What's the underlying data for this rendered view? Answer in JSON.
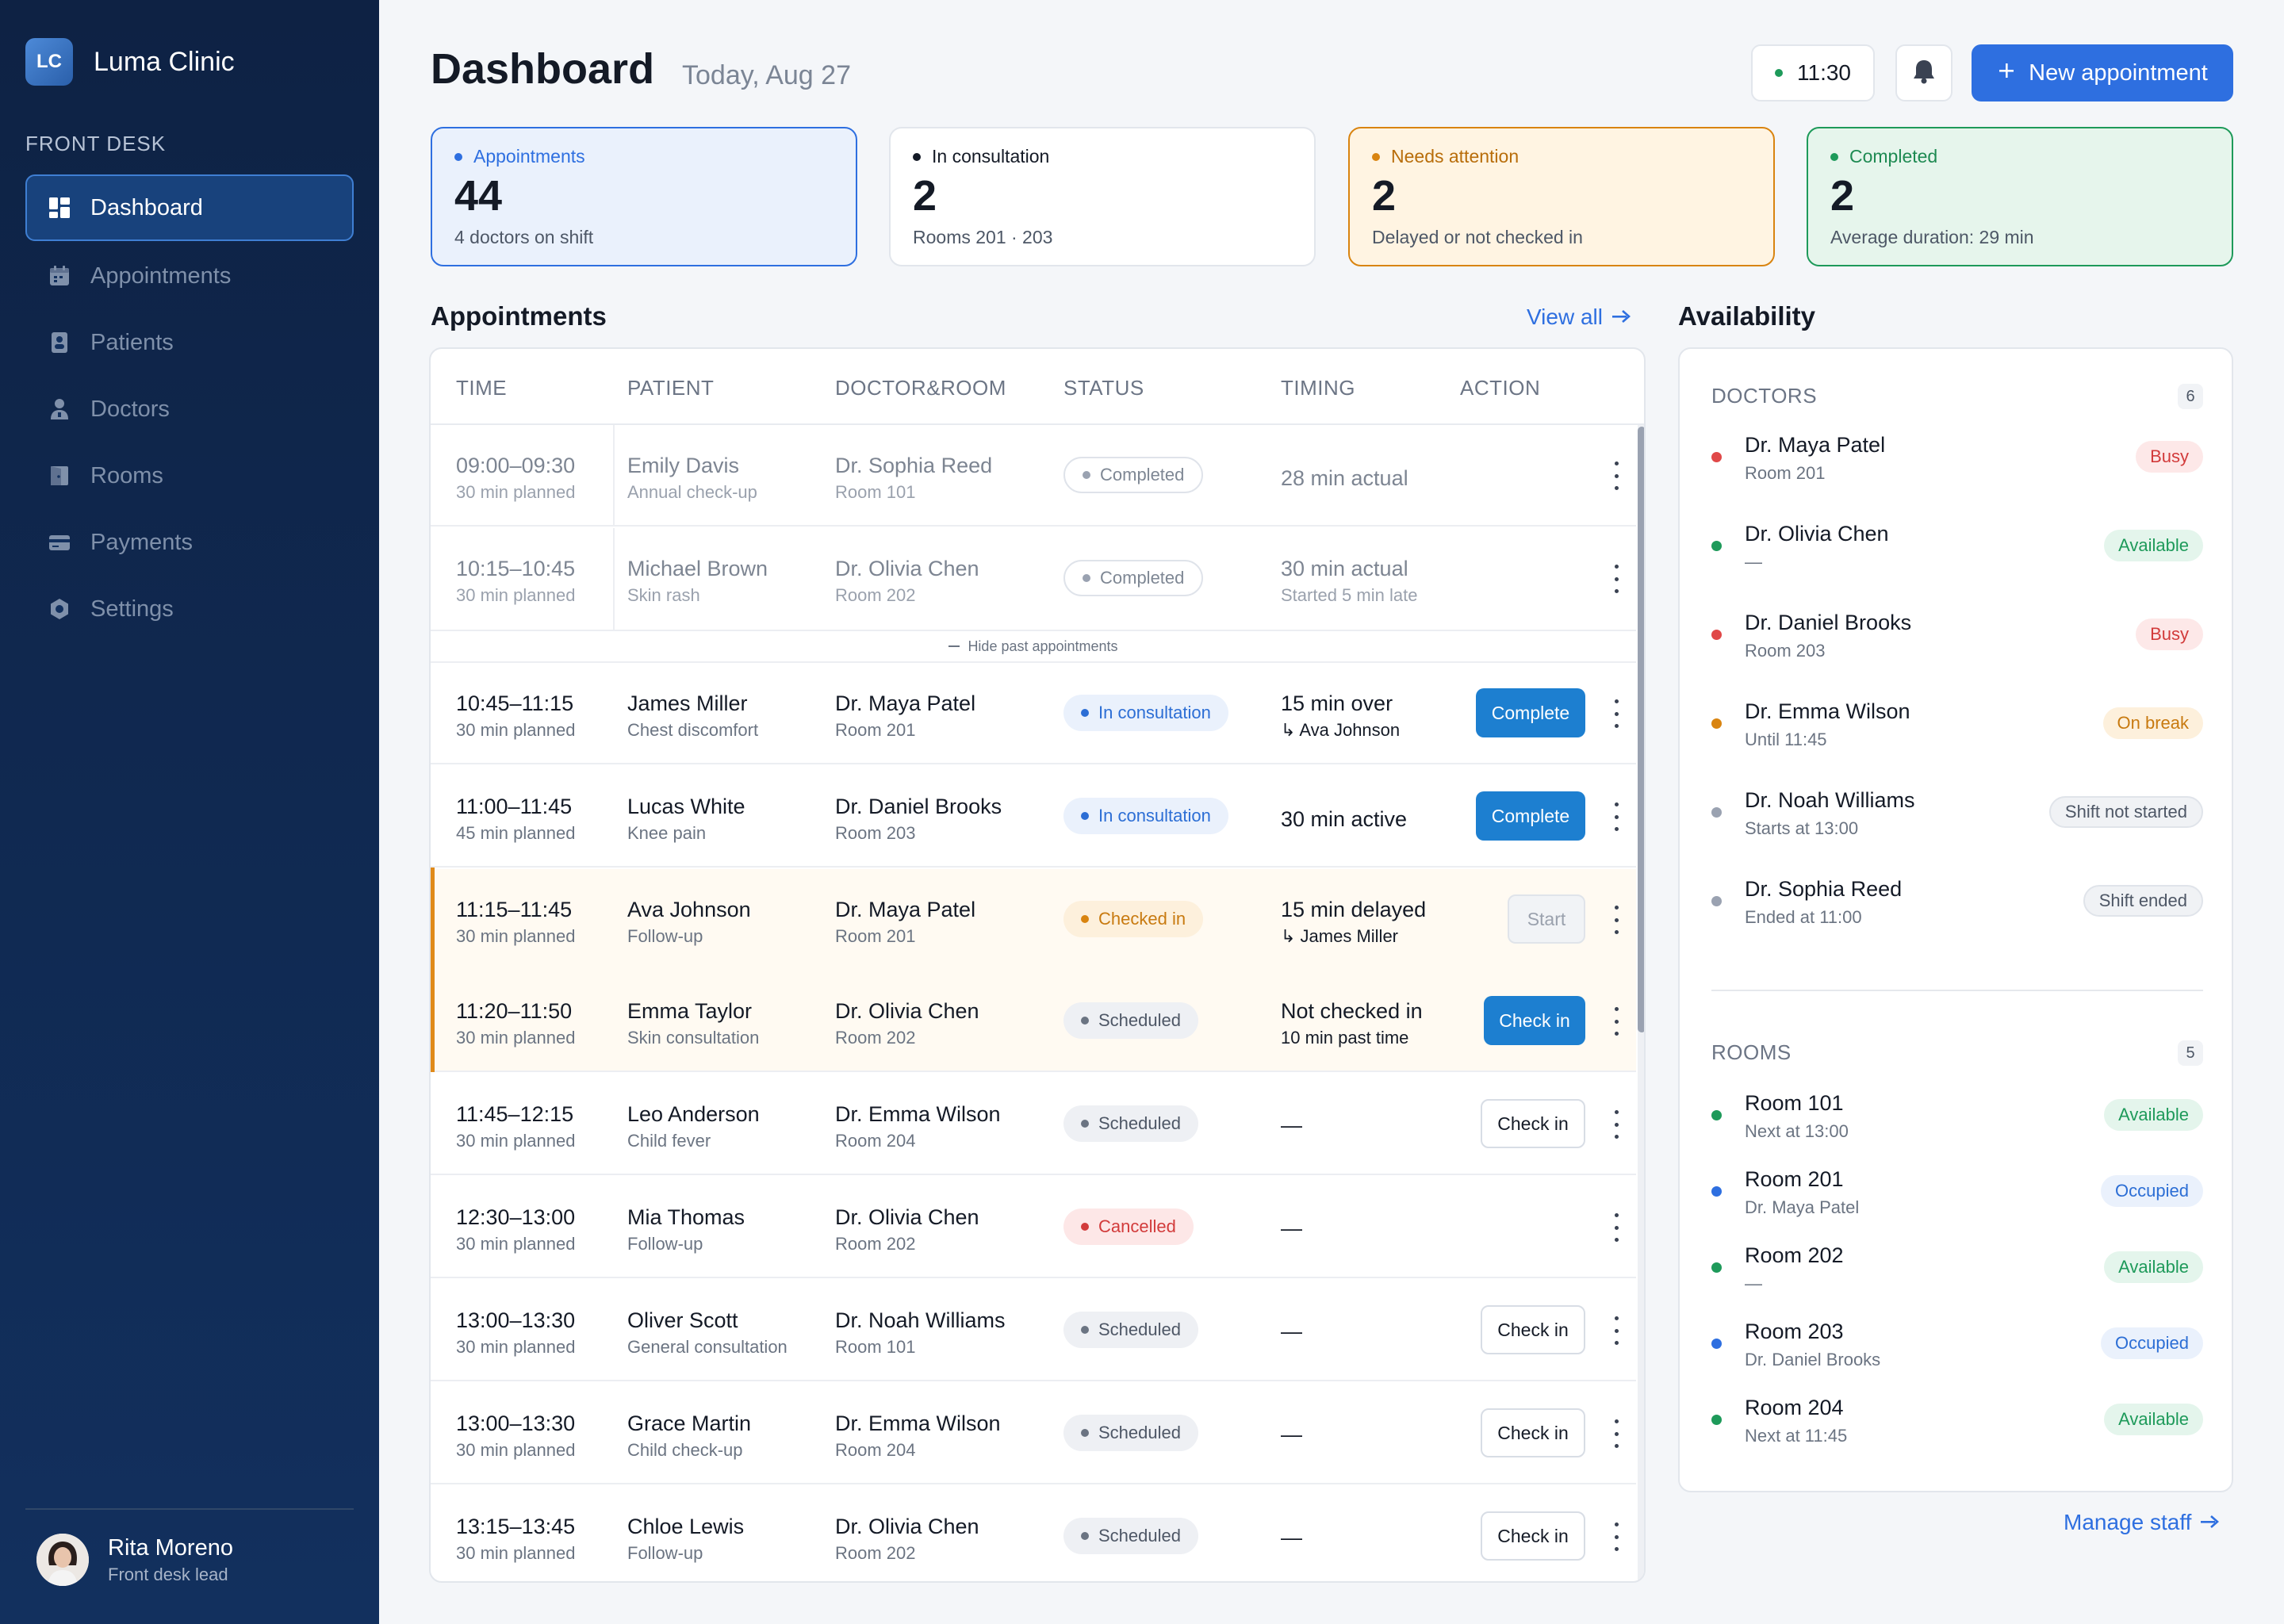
{
  "brand": {
    "initials": "LC",
    "name": "Luma Clinic"
  },
  "sidebar": {
    "section": "FRONT DESK",
    "items": [
      {
        "label": "Dashboard",
        "icon": "dashboard-icon",
        "active": true
      },
      {
        "label": "Appointments",
        "icon": "calendar-icon"
      },
      {
        "label": "Patients",
        "icon": "patient-card-icon"
      },
      {
        "label": "Doctors",
        "icon": "doctor-icon"
      },
      {
        "label": "Rooms",
        "icon": "door-icon"
      },
      {
        "label": "Payments",
        "icon": "card-icon"
      },
      {
        "label": "Settings",
        "icon": "gear-icon"
      }
    ],
    "user": {
      "name": "Rita Moreno",
      "role": "Front desk lead"
    }
  },
  "header": {
    "title": "Dashboard",
    "date": "Today, Aug 27",
    "time": "11:30",
    "new_button": "New appointment"
  },
  "stats": [
    {
      "label": "Appointments",
      "value": "44",
      "sub": "4 doctors on shift",
      "color": "#2e6fe0"
    },
    {
      "label": "In consultation",
      "value": "2",
      "sub": "Rooms 201 · 203",
      "color": "#141a26"
    },
    {
      "label": "Needs attention",
      "value": "2",
      "sub": "Delayed or not checked in",
      "color": "#d98410"
    },
    {
      "label": "Completed",
      "value": "2",
      "sub": "Average duration: 29 min",
      "color": "#1e9a5a"
    }
  ],
  "appointments": {
    "title": "Appointments",
    "view_all": "View all",
    "columns": [
      "TIME",
      "PATIENT",
      "DOCTOR&ROOM",
      "STATUS",
      "TIMING",
      "ACTION"
    ],
    "hide_past": "Hide past appointments",
    "rows": [
      {
        "time": "09:00–09:30",
        "planned": "30 min planned",
        "patient": "Emily Davis",
        "reason": "Annual check-up",
        "doctor": "Dr. Sophia Reed",
        "room": "Room 101",
        "status": "Completed",
        "timing1": "28 min actual",
        "timing2": "",
        "action": ""
      },
      {
        "time": "10:15–10:45",
        "planned": "30 min planned",
        "patient": "Michael Brown",
        "reason": "Skin rash",
        "doctor": "Dr. Olivia Chen",
        "room": "Room 202",
        "status": "Completed",
        "timing1": "30 min actual",
        "timing2": "Started 5 min late",
        "action": ""
      },
      {
        "time": "10:45–11:15",
        "planned": "30 min planned",
        "patient": "James Miller",
        "reason": "Chest discomfort",
        "doctor": "Dr. Maya Patel",
        "room": "Room 201",
        "status": "In consultation",
        "timing1": "15 min over",
        "timing2": "↳ Ava Johnson",
        "action": "Complete"
      },
      {
        "time": "11:00–11:45",
        "planned": "45 min planned",
        "patient": "Lucas White",
        "reason": "Knee pain",
        "doctor": "Dr. Daniel Brooks",
        "room": "Room 203",
        "status": "In consultation",
        "timing1": "30 min active",
        "timing2": "",
        "action": "Complete"
      },
      {
        "time": "11:15–11:45",
        "planned": "30 min planned",
        "patient": "Ava Johnson",
        "reason": "Follow-up",
        "doctor": "Dr. Maya Patel",
        "room": "Room 201",
        "status": "Checked in",
        "timing1": "15 min delayed",
        "timing2": "↳ James Miller",
        "action": "Start"
      },
      {
        "time": "11:20–11:50",
        "planned": "30 min planned",
        "patient": "Emma Taylor",
        "reason": "Skin consultation",
        "doctor": "Dr. Olivia Chen",
        "room": "Room 202",
        "status": "Scheduled",
        "timing1": "Not checked in",
        "timing2": "10 min past time",
        "action": "Check in"
      },
      {
        "time": "11:45–12:15",
        "planned": "30 min planned",
        "patient": "Leo Anderson",
        "reason": "Child fever",
        "doctor": "Dr. Emma Wilson",
        "room": "Room 204",
        "status": "Scheduled",
        "timing1": "—",
        "timing2": "",
        "action": "Check in"
      },
      {
        "time": "12:30–13:00",
        "planned": "30 min planned",
        "patient": "Mia Thomas",
        "reason": "Follow-up",
        "doctor": "Dr. Olivia Chen",
        "room": "Room 202",
        "status": "Cancelled",
        "timing1": "—",
        "timing2": "",
        "action": ""
      },
      {
        "time": "13:00–13:30",
        "planned": "30 min planned",
        "patient": "Oliver Scott",
        "reason": "General consultation",
        "doctor": "Dr. Noah Williams",
        "room": "Room 101",
        "status": "Scheduled",
        "timing1": "—",
        "timing2": "",
        "action": "Check in"
      },
      {
        "time": "13:00–13:30",
        "planned": "30 min planned",
        "patient": "Grace Martin",
        "reason": "Child check-up",
        "doctor": "Dr. Emma Wilson",
        "room": "Room 204",
        "status": "Scheduled",
        "timing1": "—",
        "timing2": "",
        "action": "Check in"
      },
      {
        "time": "13:15–13:45",
        "planned": "30 min planned",
        "patient": "Chloe Lewis",
        "reason": "Follow-up",
        "doctor": "Dr. Olivia Chen",
        "room": "Room 202",
        "status": "Scheduled",
        "timing1": "—",
        "timing2": "",
        "action": "Check in"
      }
    ]
  },
  "availability": {
    "title": "Availability",
    "doctors_label": "DOCTORS",
    "doctors_count": "6",
    "doctors": [
      {
        "name": "Dr. Maya Patel",
        "sub": "Room 201",
        "status": "Busy",
        "color": "#e04848"
      },
      {
        "name": "Dr. Olivia Chen",
        "sub": "—",
        "status": "Available",
        "color": "#1e9a5a"
      },
      {
        "name": "Dr. Daniel Brooks",
        "sub": "Room 203",
        "status": "Busy",
        "color": "#e04848"
      },
      {
        "name": "Dr. Emma Wilson",
        "sub": "Until 11:45",
        "status": "On break",
        "color": "#d98410"
      },
      {
        "name": "Dr. Noah Williams",
        "sub": "Starts at 13:00",
        "status": "Shift not started",
        "color": "#9aa2b1"
      },
      {
        "name": "Dr. Sophia Reed",
        "sub": "Ended at 11:00",
        "status": "Shift ended",
        "color": "#9aa2b1"
      }
    ],
    "rooms_label": "ROOMS",
    "rooms_count": "5",
    "rooms": [
      {
        "name": "Room 101",
        "sub": "Next at 13:00",
        "status": "Available",
        "color": "#1e9a5a"
      },
      {
        "name": "Room 201",
        "sub": "Dr. Maya Patel",
        "status": "Occupied",
        "color": "#2e6fe0"
      },
      {
        "name": "Room 202",
        "sub": "—",
        "status": "Available",
        "color": "#1e9a5a"
      },
      {
        "name": "Room 203",
        "sub": "Dr. Daniel Brooks",
        "status": "Occupied",
        "color": "#2e6fe0"
      },
      {
        "name": "Room 204",
        "sub": "Next at 11:45",
        "status": "Available",
        "color": "#1e9a5a"
      }
    ],
    "manage_staff": "Manage staff"
  }
}
